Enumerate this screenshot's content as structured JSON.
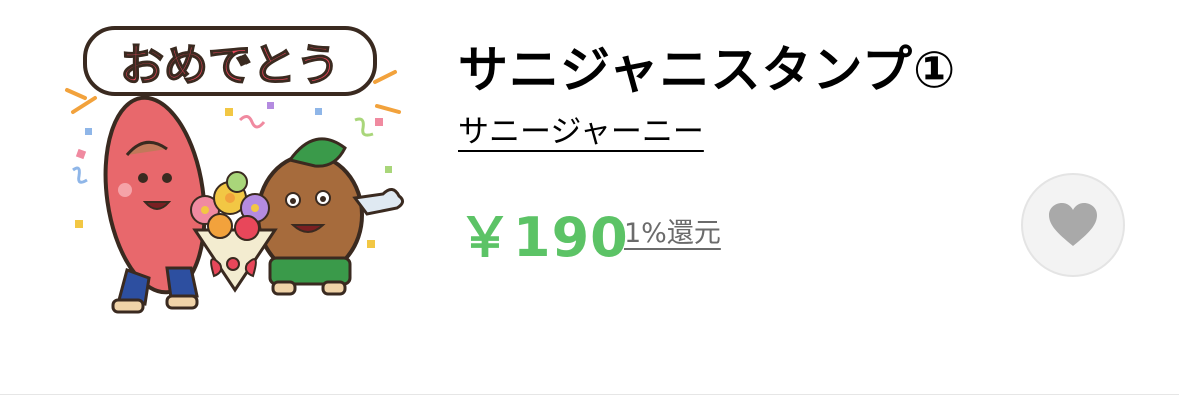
{
  "sticker": {
    "title": "サニジャニスタンプ①",
    "author": "サニージャーニー",
    "price": "￥190",
    "reward": "1%還元",
    "thumbnail_caption": "おめでとう",
    "thumbnail_icon": "congratulations-sticker-image"
  },
  "favorite": {
    "icon": "heart-icon",
    "color": "#a9a9a9"
  },
  "colors": {
    "price": "#5cc366",
    "reward_link": "#6b6b6b"
  }
}
